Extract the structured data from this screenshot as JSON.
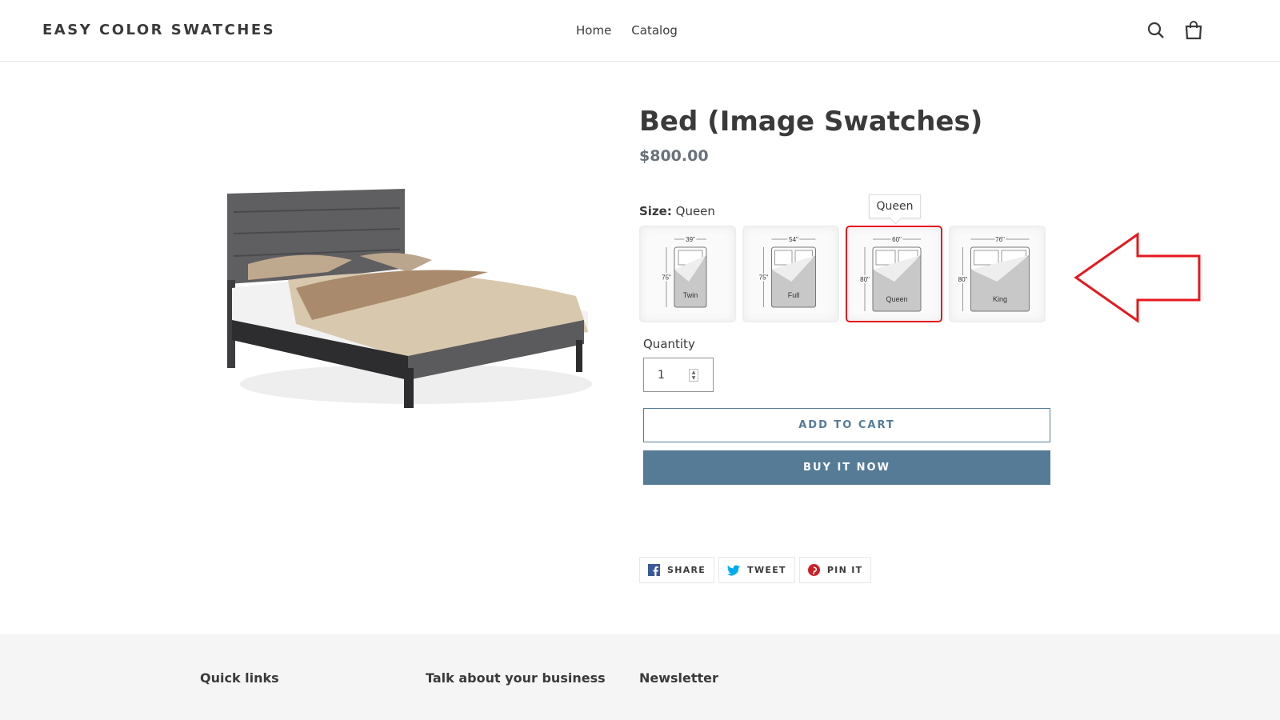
{
  "header": {
    "logo": "EASY COLOR SWATCHES",
    "nav": [
      "Home",
      "Catalog"
    ],
    "icons": [
      "search-icon",
      "cart-icon"
    ]
  },
  "product": {
    "title": "Bed (Image Swatches)",
    "price": "$800.00",
    "size_label": "Size:",
    "size_value": "Queen",
    "tooltip": "Queen",
    "swatches": [
      {
        "name": "Twin",
        "width": "39\"",
        "length": "75\""
      },
      {
        "name": "Full",
        "width": "54\"",
        "length": "75\""
      },
      {
        "name": "Queen",
        "width": "60\"",
        "length": "80\"",
        "selected": true
      },
      {
        "name": "King",
        "width": "76\"",
        "length": "80\""
      }
    ],
    "quantity_label": "Quantity",
    "quantity": "1",
    "add_to_cart": "ADD TO CART",
    "buy_now": "BUY IT NOW"
  },
  "share": [
    {
      "label": "SHARE",
      "icon": "facebook-icon"
    },
    {
      "label": "TWEET",
      "icon": "twitter-icon"
    },
    {
      "label": "PIN IT",
      "icon": "pinterest-icon"
    }
  ],
  "footer": {
    "columns": [
      "Quick links",
      "Talk about your business",
      "Newsletter"
    ]
  },
  "colors": {
    "accent": "#557b97",
    "selected_border": "#e5181e",
    "annotation_arrow": "#e5181e"
  }
}
